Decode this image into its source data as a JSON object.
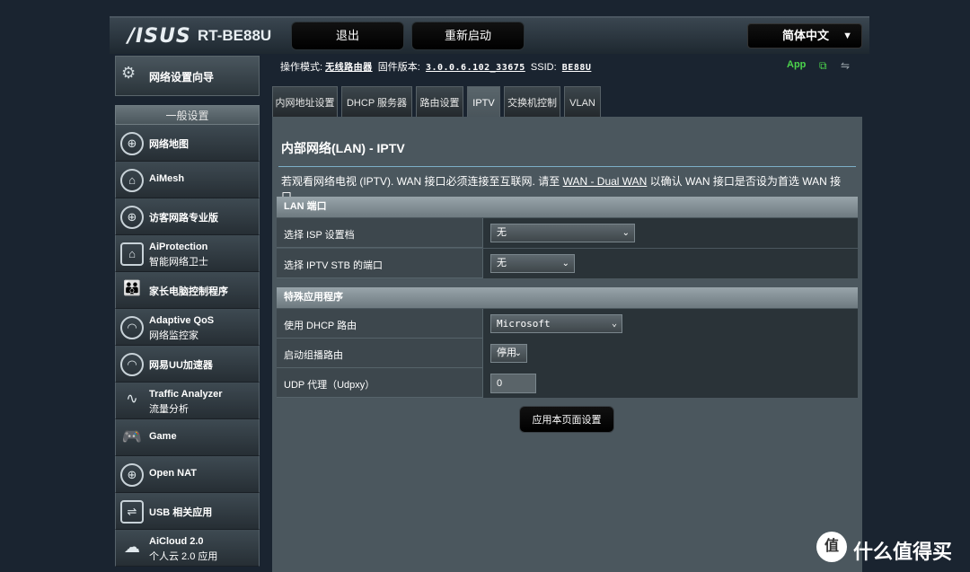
{
  "header": {
    "logo": "/ISUS",
    "model": "RT-BE88U",
    "logout_label": "退出",
    "reboot_label": "重新启动",
    "language": "简体中文"
  },
  "status": {
    "mode_label": "操作模式:",
    "mode_value": "无线路由器",
    "fw_label": "固件版本:",
    "fw_value": "3.0.0.6.102_33675",
    "ssid_label": "SSID:",
    "ssid_value": "BE88U",
    "app_label": "App"
  },
  "sidebar": {
    "wizard_label": "网络设置向导",
    "section_label": "一般设置",
    "items": [
      {
        "l1": "网络地图",
        "l2": "",
        "icon": "globe-icon"
      },
      {
        "l1": "AiMesh",
        "l2": "",
        "icon": "mesh-icon"
      },
      {
        "l1": "访客网路专业版",
        "l2": "",
        "icon": "guest-globe-icon"
      },
      {
        "l1": "AiProtection",
        "l2": "智能网络卫士",
        "icon": "shield-icon"
      },
      {
        "l1": "家长电脑控制程序",
        "l2": "",
        "icon": "family-icon"
      },
      {
        "l1": "Adaptive QoS",
        "l2": "网络监控家",
        "icon": "gauge-icon"
      },
      {
        "l1": "网易UU加速器",
        "l2": "",
        "icon": "speed-icon"
      },
      {
        "l1": "Traffic Analyzer",
        "l2": "流量分析",
        "icon": "analyzer-icon"
      },
      {
        "l1": "Game",
        "l2": "",
        "icon": "gamepad-icon"
      },
      {
        "l1": "Open NAT",
        "l2": "",
        "icon": "nat-icon"
      },
      {
        "l1": "USB 相关应用",
        "l2": "",
        "icon": "usb-icon"
      },
      {
        "l1": "AiCloud 2.0",
        "l2": "个人云 2.0 应用",
        "icon": "cloud-icon"
      }
    ]
  },
  "tabs": [
    "内网地址设置",
    "DHCP 服务器",
    "路由设置",
    "IPTV",
    "交换机控制",
    "VLAN"
  ],
  "main": {
    "title": "内部网络(LAN) - IPTV",
    "desc_pre": "若观看网络电视 (IPTV). WAN 接口必须连接至互联网. 请至 ",
    "desc_link": "WAN - Dual WAN",
    "desc_post": " 以确认 WAN 接口是否设为首选 WAN 接口。",
    "group1": "LAN 端口",
    "isp_label": "选择 ISP 设置档",
    "isp_value": "无",
    "stb_label": "选择 IPTV STB 的端口",
    "stb_value": "无",
    "group2": "特殊应用程序",
    "dhcp_label": "使用 DHCP 路由",
    "dhcp_value": "Microsoft",
    "mcast_label": "启动组播路由",
    "mcast_value": "停用",
    "udp_label": "UDP 代理（Udpxy）",
    "udp_value": "0",
    "apply_label": "应用本页面设置"
  },
  "watermark": {
    "glyph": "值",
    "text": "什么值得买"
  }
}
